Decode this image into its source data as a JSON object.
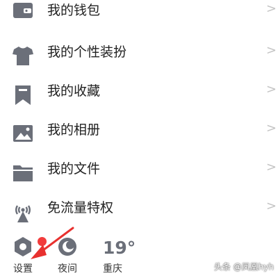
{
  "menu": {
    "items": [
      {
        "label": "我的钱包",
        "icon": "wallet-icon",
        "chevron": ">"
      },
      {
        "label": "我的个性装扮",
        "icon": "tshirt-icon",
        "chevron": ">"
      },
      {
        "label": "我的收藏",
        "icon": "bookmark-icon",
        "chevron": ">"
      },
      {
        "label": "我的相册",
        "icon": "photo-icon",
        "chevron": ">"
      },
      {
        "label": "我的文件",
        "icon": "folder-icon",
        "chevron": ">"
      },
      {
        "label": "免流量特权",
        "icon": "signal-tower-icon",
        "chevron": ">"
      }
    ]
  },
  "bottom": {
    "settings_label": "设置",
    "night_label": "夜间",
    "temperature": "19°",
    "city": "重庆",
    "notification_dot": true
  },
  "watermark": "头条 @凤凰hyh",
  "colors": {
    "icon": "#6b6f79",
    "chevron": "#c4c4c4",
    "dot": "#f23c3c",
    "arrow": "#e8312f"
  }
}
